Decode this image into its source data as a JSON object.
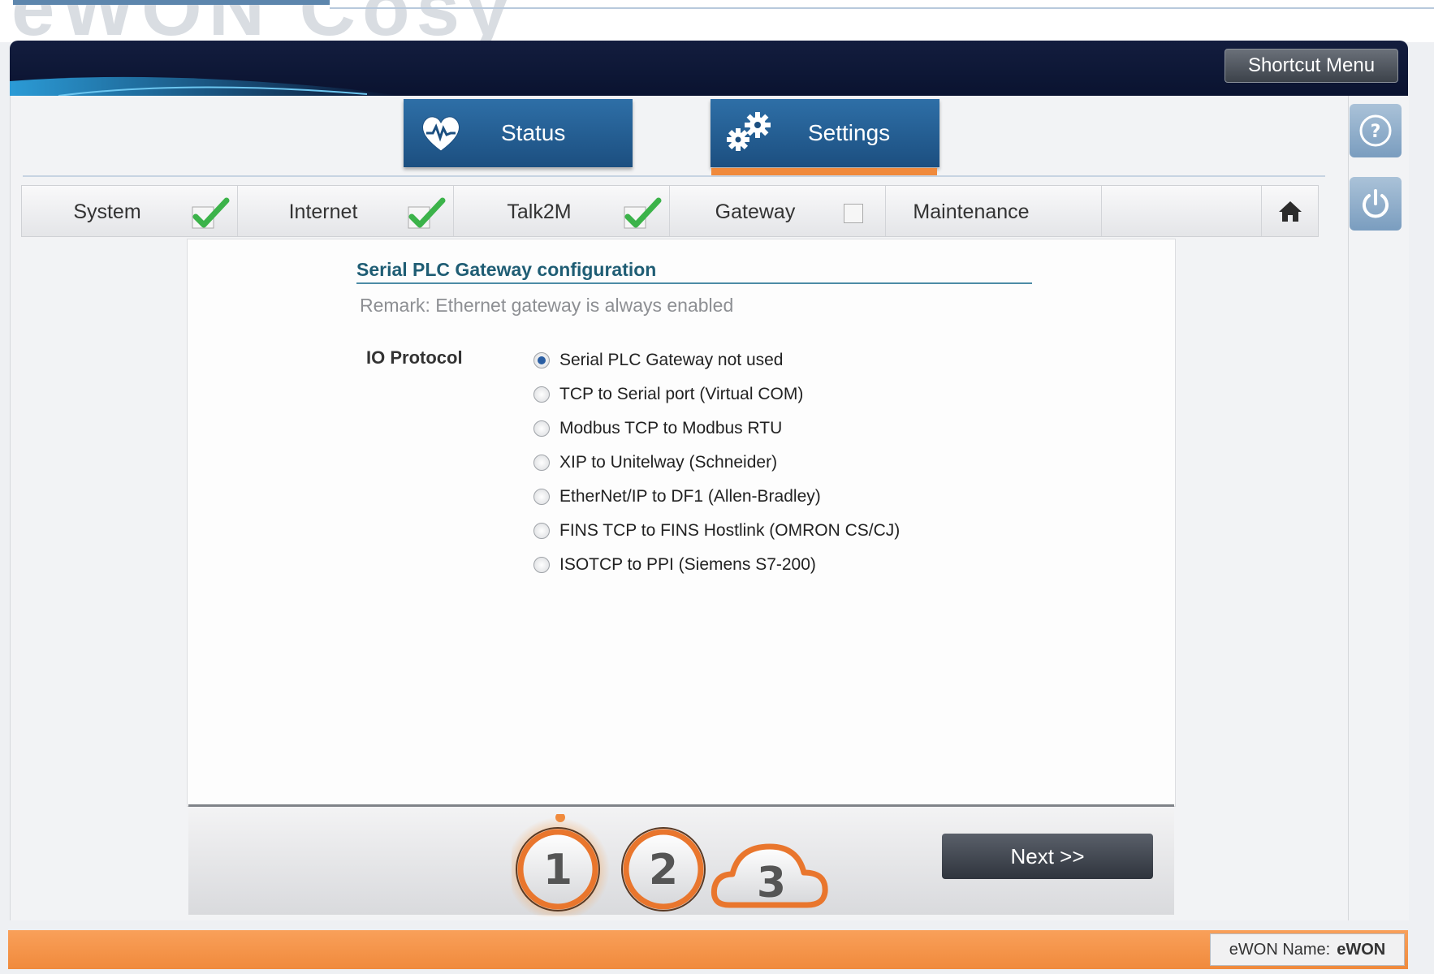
{
  "header": {
    "logo_text": "eWON Cosy",
    "shortcut_menu": "Shortcut Menu"
  },
  "main_tabs": [
    {
      "label": "Status",
      "icon": "heart-pulse-icon"
    },
    {
      "label": "Settings",
      "icon": "gears-icon",
      "active": true
    }
  ],
  "side_buttons": [
    {
      "icon": "help-icon"
    },
    {
      "icon": "power-icon"
    }
  ],
  "steps": [
    {
      "label": "System",
      "state": "checked"
    },
    {
      "label": "Internet",
      "state": "checked"
    },
    {
      "label": "Talk2M",
      "state": "checked"
    },
    {
      "label": "Gateway",
      "state": "unchecked"
    },
    {
      "label": "Maintenance",
      "state": "none"
    }
  ],
  "home_icon": "home-icon",
  "content": {
    "title": "Serial PLC Gateway configuration",
    "remark": "Remark: Ethernet gateway is always enabled",
    "io_label": "IO Protocol",
    "options": [
      {
        "label": "Serial PLC Gateway not used",
        "selected": true
      },
      {
        "label": "TCP to Serial port (Virtual COM)",
        "selected": false
      },
      {
        "label": "Modbus TCP to Modbus RTU",
        "selected": false
      },
      {
        "label": "XIP to Unitelway (Schneider)",
        "selected": false
      },
      {
        "label": "EtherNet/IP to DF1 (Allen-Bradley)",
        "selected": false
      },
      {
        "label": "FINS TCP to FINS Hostlink (OMRON CS/CJ)",
        "selected": false
      },
      {
        "label": "ISOTCP to PPI (Siemens S7-200)",
        "selected": false
      }
    ]
  },
  "wizard": {
    "steps": [
      "1",
      "2",
      "3"
    ],
    "current_step": 1,
    "next_label": "Next >>"
  },
  "statusbar": {
    "name_label": "eWON Name:",
    "name_value": "eWON"
  },
  "colors": {
    "header": "#0a1330",
    "tab_blue": "#2e6fa7",
    "accent_orange": "#f08a3c",
    "check_green": "#3cb34a",
    "title_teal": "#1f5d74"
  }
}
